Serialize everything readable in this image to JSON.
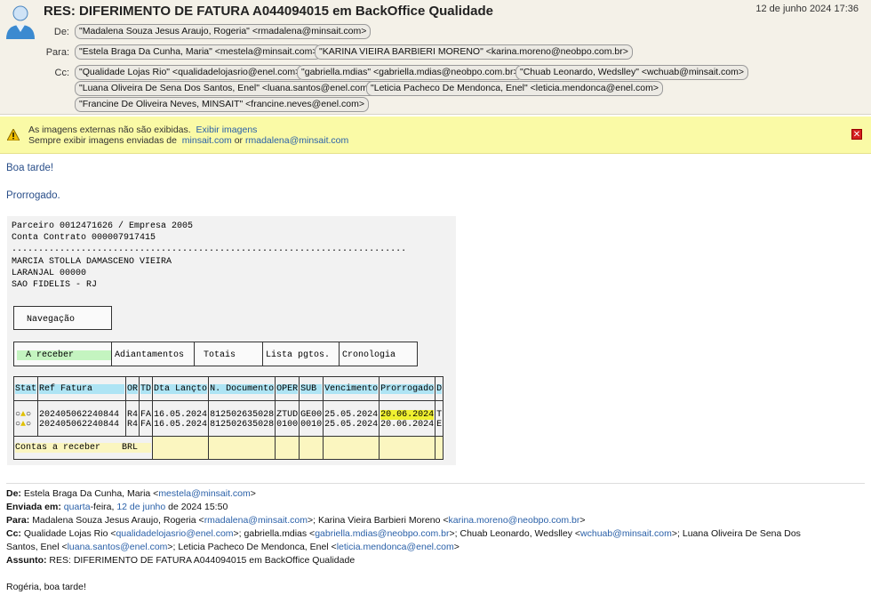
{
  "header": {
    "subject": "RES: DIFERIMENTO DE FATURA A044094015 em BackOffice Qualidade",
    "date": "12 de junho 2024 17:36",
    "from_label": "De:",
    "to_label": "Para:",
    "cc_label": "Cc:",
    "from": [
      "\"Madalena Souza Jesus Araujo, Rogeria\" <rmadalena@minsait.com>"
    ],
    "to": [
      "\"Estela Braga Da Cunha, Maria\" <mestela@minsait.com>",
      "\"KARINA VIEIRA BARBIERI MORENO\" <karina.moreno@neobpo.com.br>"
    ],
    "cc": [
      "\"Qualidade Lojas Rio\" <qualidadelojasrio@enel.com>",
      "\"gabriella.mdias\" <gabriella.mdias@neobpo.com.br>",
      "\"Chuab Leonardo, Wedslley\" <wchuab@minsait.com>",
      "\"Luana Oliveira De Sena Dos Santos, Enel\" <luana.santos@enel.com>",
      "\"Leticia Pacheco De Mendonca, Enel\" <leticia.mendonca@enel.com>",
      "\"Francine De Oliveira Neves, MINSAIT\" <francine.neves@enel.com>"
    ]
  },
  "warning": {
    "text1": "As imagens externas não são exibidas.",
    "show_link": "Exibir imagens",
    "text2": "Sempre exibir imagens enviadas de",
    "domain_link": "minsait.com",
    "or": "or",
    "sender_link": "rmadalena@minsait.com"
  },
  "body": {
    "greeting": "Boa tarde!",
    "line": "Prorrogado."
  },
  "sap": {
    "lines": [
      "Parceiro 0012471626 / Empresa 2005",
      "Conta Contrato 000007917415",
      "..........................................................................",
      "MARCIA STOLLA DAMASCENO VIEIRA",
      "LARANJAL 00000",
      "SAO FIDELIS - RJ"
    ],
    "nav": "Navegação",
    "tabs": [
      "A receber",
      "Adiantamentos",
      "Totais",
      "Lista pgtos.",
      "Cronologia"
    ],
    "columns": [
      "Stat",
      "Ref Fatura",
      "OR",
      "TD",
      "Dta Lançto",
      "N. Documento",
      "OPER",
      "SUB",
      "Vencimento",
      "Prorrogado",
      "D"
    ],
    "rows": [
      [
        "202405062240844",
        "R4",
        "FA",
        "16.05.2024",
        "812502635028",
        "ZTUD",
        "GE00",
        "25.05.2024",
        "20.06.2024",
        "T"
      ],
      [
        "202405062240844",
        "R4",
        "FA",
        "16.05.2024",
        "812502635028",
        "0100",
        "0010",
        "25.05.2024",
        "20.06.2024",
        "E"
      ]
    ],
    "footer": "Contas a receber    BRL"
  },
  "quoted": {
    "from_label": "De:",
    "from": "Estela Braga Da Cunha, Maria <",
    "from_email": "mestela@minsait.com",
    "sent_label": "Enviada em:",
    "sent_day": "quarta",
    "sent_mid": "-feira, ",
    "sent_date": "12 de junho",
    "sent_rest": " de 2024 15:50",
    "to_label": "Para:",
    "to1": "Madalena Souza Jesus Araujo, Rogeria <",
    "to1_email": "rmadalena@minsait.com",
    "to2": ">; Karina Vieira Barbieri Moreno <",
    "to2_email": "karina.moreno@neobpo.com.br",
    "cc_label": "Cc:",
    "cc1": "Qualidade Lojas Rio <",
    "cc1_email": "qualidadelojasrio@enel.com",
    "cc2": ">; gabriella.mdias <",
    "cc2_email": "gabriella.mdias@neobpo.com.br",
    "cc3": ">; Chuab Leonardo, Wedslley <",
    "cc3_email": "wchuab@minsait.com",
    "cc4": ">; Luana Oliveira De Sena Dos",
    "cc5": "Santos, Enel <",
    "cc5_email": "luana.santos@enel.com",
    "cc6": ">; Leticia Pacheco De Mendonca, Enel <",
    "cc6_email": "leticia.mendonca@enel.com",
    "subject_label": "Assunto:",
    "subject": "RES: DIFERIMENTO DE FATURA A044094015 em BackOffice Qualidade",
    "greeting": "Rogéria, boa tarde!"
  }
}
